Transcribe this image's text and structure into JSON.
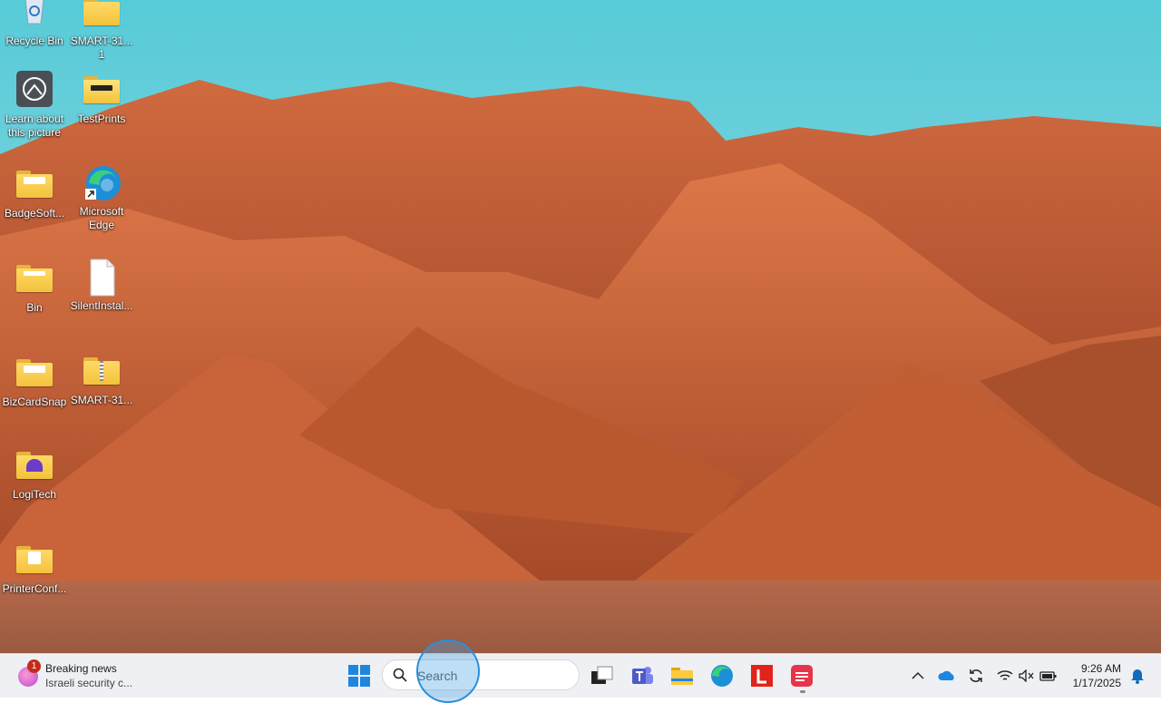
{
  "desktop_icons": [
    {
      "label": "Recycle Bin",
      "icon": "recycle-bin-icon"
    },
    {
      "label": "SMART-31...\n1",
      "icon": "folder-icon"
    },
    {
      "label": "Learn about this picture",
      "icon": "learn-about-picture-icon"
    },
    {
      "label": "TestPrints",
      "icon": "folder-icon"
    },
    {
      "label": "BadgeSoft...",
      "icon": "folder-icon"
    },
    {
      "label": "Microsoft Edge",
      "icon": "edge-icon"
    },
    {
      "label": "Bin",
      "icon": "folder-icon"
    },
    {
      "label": "SilentInstal...",
      "icon": "file-icon"
    },
    {
      "label": "BizCardSnap",
      "icon": "folder-icon"
    },
    {
      "label": "SMART-31...",
      "icon": "zip-folder-icon"
    },
    {
      "label": "LogiTech",
      "icon": "folder-icon"
    },
    {
      "label": "PrinterConf...",
      "icon": "folder-icon"
    }
  ],
  "taskbar": {
    "news": {
      "title": "Breaking news",
      "subtitle": "Israeli security c...",
      "badge": "1"
    },
    "search": {
      "placeholder": "Search"
    },
    "pinned_apps": [
      "start-button",
      "work-briefcase-icon",
      "task-view-icon",
      "teams-icon",
      "file-explorer-icon",
      "edge-icon",
      "lenovo-l-icon",
      "app-red-icon"
    ],
    "tray_icons": [
      "chevron-up-icon",
      "onedrive-cloud-icon",
      "sync-icon",
      "wifi-icon",
      "speaker-muted-icon",
      "battery-icon"
    ],
    "clock": {
      "time": "9:26 AM",
      "date": "1/17/2025"
    },
    "notification_icon": "bell-icon"
  },
  "colors": {
    "accent": "#0078d4",
    "taskbar_bg": "#eef0f3"
  }
}
